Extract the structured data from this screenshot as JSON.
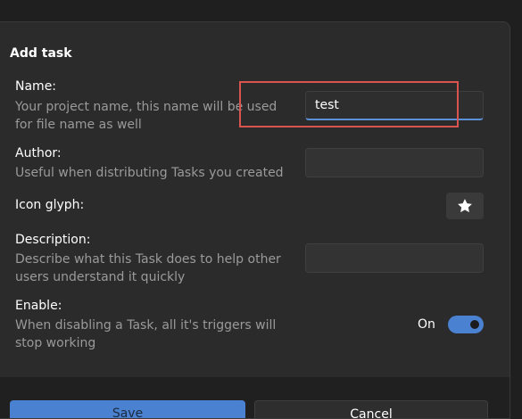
{
  "dialog": {
    "title": "Add task",
    "fields": {
      "name": {
        "label": "Name:",
        "description": "Your project name, this name will be used for file name as well",
        "value": "test"
      },
      "author": {
        "label": "Author:",
        "description": "Useful when distributing Tasks you created",
        "value": ""
      },
      "icon": {
        "label": "Icon glyph:",
        "icon": "star-icon"
      },
      "description": {
        "label": "Description:",
        "description": "Describe what this Task does to help other users understand it quickly",
        "value": ""
      },
      "enable": {
        "label": "Enable:",
        "description": "When disabling a Task, all it's triggers will stop working",
        "state_label": "On",
        "state": true
      }
    },
    "buttons": {
      "save": "Save",
      "cancel": "Cancel"
    }
  },
  "colors": {
    "accent": "#4a82d1",
    "highlight": "#d9534f",
    "background": "#2b2b2b"
  }
}
